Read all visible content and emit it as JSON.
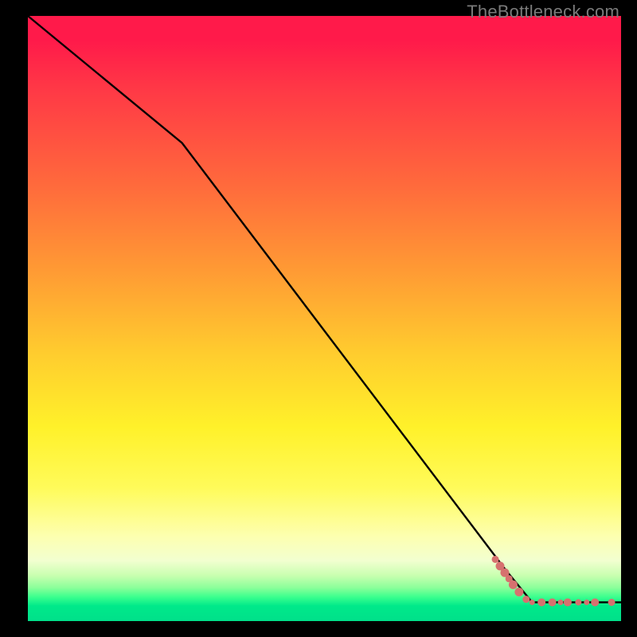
{
  "brand_text": "TheBottleneck.com",
  "dot_color": "#d6716f",
  "line_color": "#000000",
  "chart_data": {
    "type": "line",
    "title": "",
    "xlabel": "",
    "ylabel": "",
    "xlim": [
      0,
      100
    ],
    "ylim": [
      0,
      100
    ],
    "grid": false,
    "legend": false,
    "line_points": [
      {
        "x": 0,
        "y": 100
      },
      {
        "x": 26,
        "y": 79
      },
      {
        "x": 80.5,
        "y": 8.5
      },
      {
        "x": 85,
        "y": 3.1
      },
      {
        "x": 100,
        "y": 3.1
      }
    ],
    "scatter_series": {
      "name": "highlighted-segment",
      "points": [
        {
          "x": 78.8,
          "y": 10.2,
          "r": 4.5
        },
        {
          "x": 79.6,
          "y": 9.1,
          "r": 5.5
        },
        {
          "x": 80.4,
          "y": 8.0,
          "r": 5.5
        },
        {
          "x": 81.1,
          "y": 7.0,
          "r": 4.5
        },
        {
          "x": 81.8,
          "y": 6.0,
          "r": 5.5
        },
        {
          "x": 82.8,
          "y": 4.8,
          "r": 5.5
        },
        {
          "x": 84.0,
          "y": 3.6,
          "r": 4.5
        },
        {
          "x": 85.0,
          "y": 3.1,
          "r": 3.5
        },
        {
          "x": 86.6,
          "y": 3.1,
          "r": 5.0
        },
        {
          "x": 88.4,
          "y": 3.1,
          "r": 5.0
        },
        {
          "x": 89.8,
          "y": 3.1,
          "r": 3.5
        },
        {
          "x": 91.0,
          "y": 3.1,
          "r": 5.0
        },
        {
          "x": 92.8,
          "y": 3.1,
          "r": 4.0
        },
        {
          "x": 94.2,
          "y": 3.1,
          "r": 3.5
        },
        {
          "x": 95.6,
          "y": 3.1,
          "r": 5.0
        },
        {
          "x": 98.4,
          "y": 3.1,
          "r": 4.5
        }
      ]
    }
  }
}
